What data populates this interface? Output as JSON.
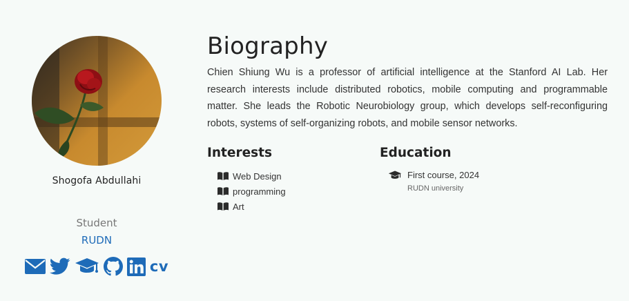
{
  "profile": {
    "name": "Shogofa Abdullahi",
    "role": "Student",
    "organization": "RUDN",
    "socials": [
      {
        "icon": "envelope-icon"
      },
      {
        "icon": "twitter-icon"
      },
      {
        "icon": "graduation-cap-icon"
      },
      {
        "icon": "github-icon"
      },
      {
        "icon": "linkedin-icon"
      },
      {
        "icon": "cv-icon",
        "label": "cv"
      }
    ],
    "accent_color": "#1e6bb8"
  },
  "biography": {
    "title": "Biography",
    "text": "Chien Shiung Wu is a professor of artificial intelligence at the Stanford AI Lab. Her research interests include distributed robotics, mobile computing and programmable matter. She leads the Robotic Neurobiology group, which develops self-reconfiguring robots, systems of self-organizing robots, and mobile sensor networks."
  },
  "interests": {
    "title": "Interests",
    "icon": "book-icon",
    "items": [
      "Web Design",
      "programming",
      "Art"
    ]
  },
  "education": {
    "title": "Education",
    "icon": "graduation-cap-icon",
    "items": [
      {
        "course": "First course, 2024",
        "institution": "RUDN university"
      }
    ]
  }
}
